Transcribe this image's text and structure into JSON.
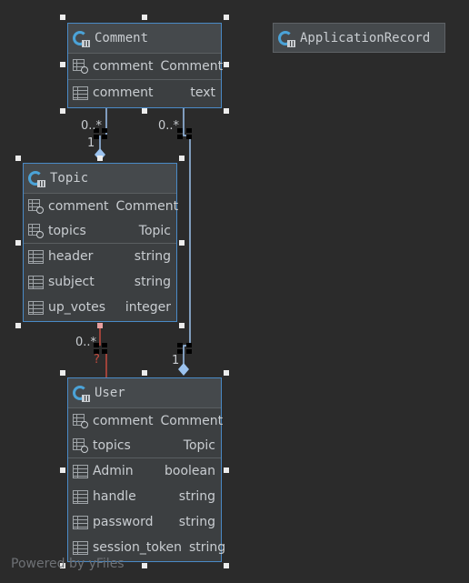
{
  "colors": {
    "background": "#2b2b2b",
    "node_fill": "#3c3f41",
    "selected_border": "#4a8ac6",
    "edge": "#9cc3ef",
    "edge_highlight": "#c44b3e"
  },
  "nodes": {
    "comment": {
      "title": "Comment",
      "associations": [
        {
          "name": "comment",
          "type": "Comment"
        }
      ],
      "fields": [
        {
          "name": "comment",
          "type": "text"
        }
      ]
    },
    "application_record": {
      "title": "ApplicationRecord"
    },
    "topic": {
      "title": "Topic",
      "associations": [
        {
          "name": "comment",
          "type": "Comment"
        },
        {
          "name": "topics",
          "type": "Topic"
        }
      ],
      "fields": [
        {
          "name": "header",
          "type": "string"
        },
        {
          "name": "subject",
          "type": "string"
        },
        {
          "name": "up_votes",
          "type": "integer"
        }
      ]
    },
    "user": {
      "title": "User",
      "associations": [
        {
          "name": "comment",
          "type": "Comment"
        },
        {
          "name": "topics",
          "type": "Topic"
        }
      ],
      "fields": [
        {
          "name": "Admin",
          "type": "boolean"
        },
        {
          "name": "handle",
          "type": "string"
        },
        {
          "name": "password",
          "type": "string"
        },
        {
          "name": "session_token",
          "type": "string"
        }
      ]
    }
  },
  "edges": {
    "comment_topic": {
      "source_multiplicity": "0..*",
      "target_multiplicity": "1"
    },
    "comment_user": {
      "source_multiplicity": "0..*",
      "target_multiplicity": "1"
    },
    "topic_user": {
      "source_multiplicity": "0..*",
      "target_multiplicity": "?"
    }
  },
  "watermark": "Powered by yFiles"
}
